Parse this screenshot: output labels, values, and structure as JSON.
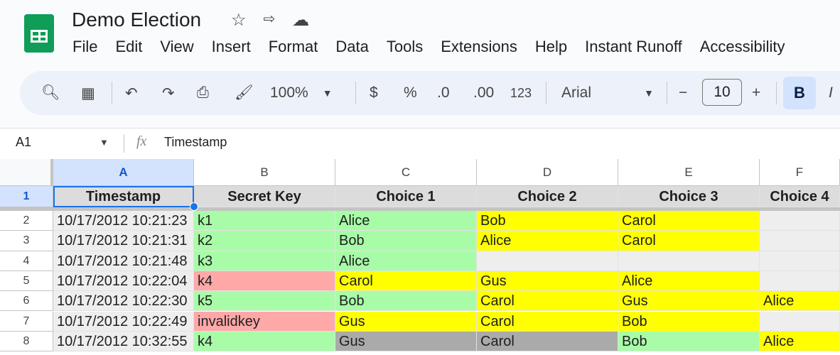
{
  "app": {
    "title": "Demo Election",
    "menu": [
      "File",
      "Edit",
      "View",
      "Insert",
      "Format",
      "Data",
      "Tools",
      "Extensions",
      "Help",
      "Instant Runoff",
      "Accessibility"
    ]
  },
  "toolbar": {
    "zoom": "100%",
    "currency": "$",
    "percent": "%",
    "dec_decrease": ".0",
    "dec_increase": ".00",
    "number_format": "123",
    "font": "Arial",
    "font_size": "10",
    "minus": "−",
    "plus": "+",
    "bold": "B",
    "italic": "I"
  },
  "formula_bar": {
    "cell_ref": "A1",
    "fx": "fx",
    "value": "Timestamp"
  },
  "columns": [
    "A",
    "B",
    "C",
    "D",
    "E",
    "F"
  ],
  "rows": [
    {
      "n": "1",
      "cells": [
        "Timestamp",
        "Secret Key",
        "Choice 1",
        "Choice 2",
        "Choice 3",
        "Choice 4"
      ]
    },
    {
      "n": "2",
      "cells": [
        "10/17/2012 10:21:23",
        "k1",
        "Alice",
        "Bob",
        "Carol",
        ""
      ]
    },
    {
      "n": "3",
      "cells": [
        "10/17/2012 10:21:31",
        "k2",
        "Bob",
        "Alice",
        "Carol",
        ""
      ]
    },
    {
      "n": "4",
      "cells": [
        "10/17/2012 10:21:48",
        "k3",
        "Alice",
        "",
        "",
        ""
      ]
    },
    {
      "n": "5",
      "cells": [
        "10/17/2012 10:22:04",
        "k4",
        "Carol",
        "Gus",
        "Alice",
        ""
      ]
    },
    {
      "n": "6",
      "cells": [
        "10/17/2012 10:22:30",
        "k5",
        "Bob",
        "Carol",
        "Gus",
        "Alice"
      ]
    },
    {
      "n": "7",
      "cells": [
        "10/17/2012 10:22:49",
        "invalidkey",
        "Gus",
        "Carol",
        "Bob",
        ""
      ]
    },
    {
      "n": "8",
      "cells": [
        "10/17/2012 10:32:55",
        "k4",
        "Gus",
        "Carol",
        "Bob",
        "Alice"
      ]
    }
  ],
  "fills": [
    [
      "#dcdcdc",
      "#dcdcdc",
      "#dcdcdc",
      "#dcdcdc",
      "#dcdcdc",
      "#dcdcdc"
    ],
    [
      "#eeeeee",
      "#a8fca8",
      "#a8fca8",
      "#ffff00",
      "#ffff00",
      "#eeeeee"
    ],
    [
      "#eeeeee",
      "#a8fca8",
      "#a8fca8",
      "#ffff00",
      "#ffff00",
      "#eeeeee"
    ],
    [
      "#eeeeee",
      "#a8fca8",
      "#a8fca8",
      "#eeeeee",
      "#eeeeee",
      "#eeeeee"
    ],
    [
      "#eeeeee",
      "#ffa8a8",
      "#ffff00",
      "#ffff00",
      "#ffff00",
      "#eeeeee"
    ],
    [
      "#eeeeee",
      "#a8fca8",
      "#a8fca8",
      "#ffff00",
      "#ffff00",
      "#ffff00"
    ],
    [
      "#eeeeee",
      "#ffa8a8",
      "#ffff00",
      "#ffff00",
      "#ffff00",
      "#eeeeee"
    ],
    [
      "#eeeeee",
      "#a8fca8",
      "#aaaaaa",
      "#aaaaaa",
      "#a8fca8",
      "#ffff00"
    ]
  ]
}
